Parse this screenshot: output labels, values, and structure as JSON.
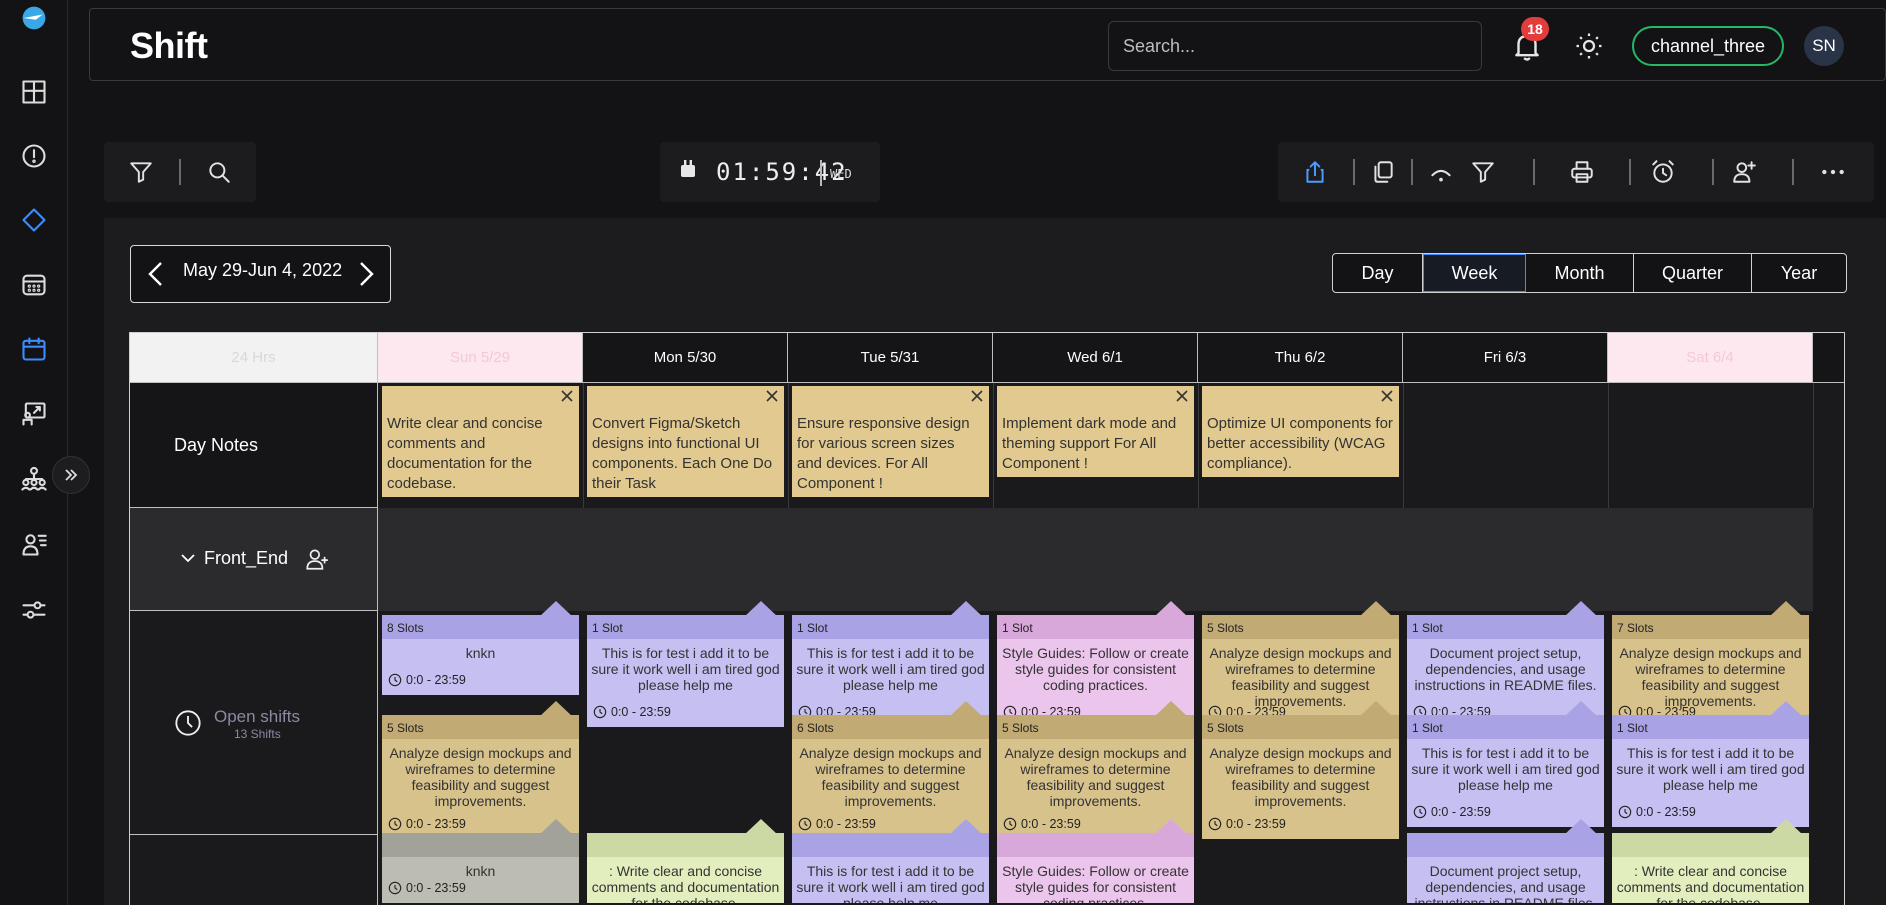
{
  "header": {
    "title": "Shift",
    "search_placeholder": "Search...",
    "notification_count": "18",
    "channel": "channel_three",
    "avatar_initials": "SN"
  },
  "sidebar": {
    "icons": [
      "logo-icon",
      "dashboard-icon",
      "alert-icon",
      "diamond-icon",
      "calendar-grid-icon",
      "calendar-icon",
      "screen-share-icon",
      "org-chart-icon",
      "user-list-icon",
      "sliders-icon"
    ]
  },
  "clock": {
    "time": "01:59:42",
    "day": "WED"
  },
  "date_range": "May 29-Jun 4, 2022",
  "views": [
    "Day",
    "Week",
    "Month",
    "Quarter",
    "Year"
  ],
  "active_view": "Week",
  "colors": {
    "note": "#e1c98f",
    "purple": "#c6c0f2",
    "purple_hdr": "#a9a2e4",
    "tan": "#d8c28c",
    "tan_hdr": "#c2aa74",
    "pink": "#ebc5ec",
    "pink_hdr": "#d8a8da",
    "gray": "#bcbcb2",
    "gray_hdr": "#a2a29a",
    "green": "#e3eebf",
    "green_hdr": "#cdd9a4",
    "active_view": "#3b8cff",
    "channel_border": "#25b865"
  },
  "grid": {
    "hours_label": "24 Hrs",
    "days": [
      "Sun 5/29",
      "Mon 5/30",
      "Tue 5/31",
      "Wed 6/1",
      "Thu 6/2",
      "Fri 6/3",
      "Sat 6/4"
    ],
    "day_notes_label": "Day Notes",
    "notes": [
      "Write clear and concise comments and documentation for the codebase.",
      "Convert Figma/Sketch designs into functional UI components. Each One Do their Task",
      "Ensure responsive design for various screen sizes and devices. For All Component !",
      "Implement dark mode and theming support For All Component !",
      "Optimize UI components for better accessibility (WCAG compliance)."
    ],
    "group_label": "Front_End",
    "open_shifts_label": "Open shifts",
    "open_shifts_count": "13 Shifts",
    "shifts": [
      {
        "day": 0,
        "row": 0,
        "color": "purple",
        "slots": "8 Slots",
        "text": "knkn",
        "time": "0:0 - 23:59",
        "h": 80
      },
      {
        "day": 1,
        "row": 0,
        "color": "purple",
        "slots": "1 Slot",
        "text": "This is for test i add it to be sure it work well i am tired god please help me",
        "time": "0:0 - 23:59",
        "h": 112
      },
      {
        "day": 2,
        "row": 0,
        "color": "purple",
        "slots": "1 Slot",
        "text": "This is for test i add it to be sure it work well i am tired god please help me",
        "time": "0:0 - 23:59",
        "h": 112
      },
      {
        "day": 3,
        "row": 0,
        "color": "pink",
        "slots": "1 Slot",
        "text": "Style Guides: Follow or create style guides for consistent coding practices.",
        "time": "0:0 - 23:59",
        "h": 112
      },
      {
        "day": 4,
        "row": 0,
        "color": "tan",
        "slots": "5 Slots",
        "text": "Analyze design mockups and wireframes to determine feasibility and suggest improvements.",
        "time": "0:0 - 23:59",
        "h": 112
      },
      {
        "day": 5,
        "row": 0,
        "color": "purple",
        "slots": "1 Slot",
        "text": "Document project setup, dependencies, and usage instructions in README files.",
        "time": "0:0 - 23:59",
        "h": 112
      },
      {
        "day": 6,
        "row": 0,
        "color": "tan",
        "slots": "7 Slots",
        "text": "Analyze design mockups and wireframes to determine feasibility and suggest improvements.",
        "time": "0:0 - 23:59",
        "h": 112
      },
      {
        "day": 0,
        "row": 1,
        "color": "tan",
        "slots": "5 Slots",
        "text": "Analyze design mockups and wireframes to determine feasibility and suggest improvements.",
        "time": "0:0 - 23:59",
        "h": 124
      },
      {
        "day": 2,
        "row": 1,
        "color": "tan",
        "slots": "6 Slots",
        "text": "Analyze design mockups and wireframes to determine feasibility and suggest improvements.",
        "time": "0:0 - 23:59",
        "h": 124
      },
      {
        "day": 3,
        "row": 1,
        "color": "tan",
        "slots": "5 Slots",
        "text": "Analyze design mockups and wireframes to determine feasibility and suggest improvements.",
        "time": "0:0 - 23:59",
        "h": 124
      },
      {
        "day": 4,
        "row": 1,
        "color": "tan",
        "slots": "5 Slots",
        "text": "Analyze design mockups and wireframes to determine feasibility and suggest improvements.",
        "time": "0:0 - 23:59",
        "h": 124
      },
      {
        "day": 5,
        "row": 1,
        "color": "purple",
        "slots": "1 Slot",
        "text": "This is for test i add it to be sure it work well i am tired god please help me",
        "time": "0:0 - 23:59",
        "h": 112
      },
      {
        "day": 6,
        "row": 1,
        "color": "purple",
        "slots": "1 Slot",
        "text": "This is for test i add it to be sure it work well i am tired god please help me",
        "time": "0:0 - 23:59",
        "h": 112
      },
      {
        "day": 0,
        "row": 2,
        "color": "gray",
        "slots": "",
        "text": "knkn",
        "time": "0:0 - 23:59",
        "h": 70
      },
      {
        "day": 1,
        "row": 2,
        "color": "green",
        "slots": "",
        "text": ": Write clear and concise comments and documentation for the codebase.",
        "time": "",
        "h": 70
      },
      {
        "day": 2,
        "row": 2,
        "color": "purple",
        "slots": "",
        "text": "This is for test i add it to be sure it work well i am tired god please help me",
        "time": "",
        "h": 70
      },
      {
        "day": 3,
        "row": 2,
        "color": "pink",
        "slots": "",
        "text": "Style Guides: Follow or create style guides for consistent coding practices.",
        "time": "",
        "h": 70
      },
      {
        "day": 5,
        "row": 2,
        "color": "purple",
        "slots": "",
        "text": "Document project setup, dependencies, and usage instructions in README files.",
        "time": "",
        "h": 70
      },
      {
        "day": 6,
        "row": 2,
        "color": "green",
        "slots": "",
        "text": ": Write clear and concise comments and documentation for the codebase.",
        "time": "",
        "h": 70
      }
    ]
  }
}
